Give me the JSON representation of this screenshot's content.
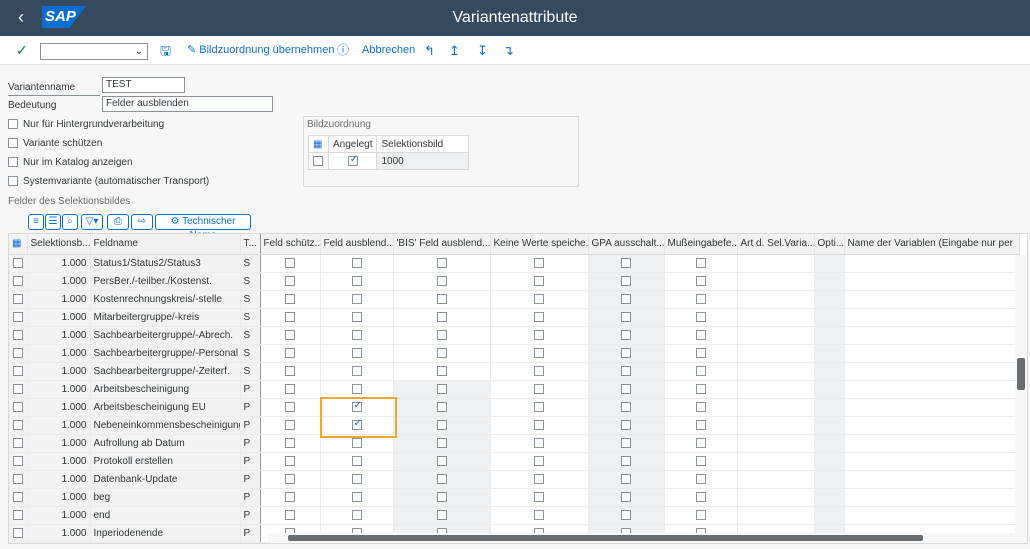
{
  "titlebar": {
    "back_icon": "chevron-left-icon",
    "logo": "SAP",
    "title": "Variantenattribute"
  },
  "toolbar": {
    "check_icon": "check-icon",
    "dropdown_value": "",
    "save_icon": "save-icon",
    "bild_label": "Bildzuordnung übernehmen",
    "info_icon": "info-icon",
    "cancel_label": "Abbrechen"
  },
  "form": {
    "variant_name_label": "Variantenname",
    "variant_name_value": "TEST",
    "meaning_label": "Bedeutung",
    "meaning_value": "Felder ausblenden",
    "options": [
      {
        "label": "Nur für Hintergrundverarbeitung",
        "checked": false
      },
      {
        "label": "Variante schützen",
        "checked": false
      },
      {
        "label": "Nur im Katalog anzeigen",
        "checked": false
      },
      {
        "label": "Systemvariante (automatischer Transport)",
        "checked": false
      }
    ]
  },
  "bildzuordnung": {
    "title": "Bildzuordnung",
    "col_created": "Angelegt",
    "col_screen": "Selektionsbild",
    "row_screen": "1000",
    "row_created": true
  },
  "section_title": "Felder des Selektionsbildes",
  "tech_name_button": "Technischer Name",
  "grid": {
    "headers": [
      "Selektionsb...",
      "Feldname",
      "T...",
      "Feld schütz...",
      "Feld ausblend...",
      "'BIS' Feld ausblend...",
      "Keine Werte speiche...",
      "GPA ausschalt...",
      "Mußeingabefe...",
      "Art d. Sel.Varia...",
      "Opti...",
      "Name der Variablen (Eingabe nur per"
    ],
    "rows": [
      {
        "screen": "1.000",
        "field": "Status1/Status2/Status3",
        "type": "S",
        "hide": false
      },
      {
        "screen": "1.000",
        "field": "PersBer./-teilber./Kostenst.",
        "type": "S",
        "hide": false
      },
      {
        "screen": "1.000",
        "field": "Kostenrechnungskreis/-stelle",
        "type": "S",
        "hide": false
      },
      {
        "screen": "1.000",
        "field": "Mitarbeitergruppe/-kreis",
        "type": "S",
        "hide": false
      },
      {
        "screen": "1.000",
        "field": "Sachbearbeitergruppe/-Abrech.",
        "type": "S",
        "hide": false
      },
      {
        "screen": "1.000",
        "field": "Sachbearbeitergruppe/-Personal",
        "type": "S",
        "hide": false
      },
      {
        "screen": "1.000",
        "field": "Sachbearbeitergruppe/-Zeiterf.",
        "type": "S",
        "hide": false
      },
      {
        "screen": "1.000",
        "field": "Arbeitsbescheinigung",
        "type": "P",
        "hide": false
      },
      {
        "screen": "1.000",
        "field": "Arbeitsbescheinigung EU",
        "type": "P",
        "hide": true
      },
      {
        "screen": "1.000",
        "field": "Nebeneinkommensbescheinigung",
        "type": "P",
        "hide": true
      },
      {
        "screen": "1.000",
        "field": "Aufrollung ab Datum",
        "type": "P",
        "hide": false
      },
      {
        "screen": "1.000",
        "field": "Protokoll erstellen",
        "type": "P",
        "hide": false
      },
      {
        "screen": "1.000",
        "field": "Datenbank-Update",
        "type": "P",
        "hide": false
      },
      {
        "screen": "1.000",
        "field": "beg",
        "type": "P",
        "hide": false
      },
      {
        "screen": "1.000",
        "field": "end",
        "type": "P",
        "hide": false
      },
      {
        "screen": "1.000",
        "field": "Inperiodenende",
        "type": "P",
        "hide": false
      }
    ]
  },
  "colors": {
    "shell": "#354a5f",
    "accent": "#0a6ed1",
    "highlight": "#f0a830"
  }
}
